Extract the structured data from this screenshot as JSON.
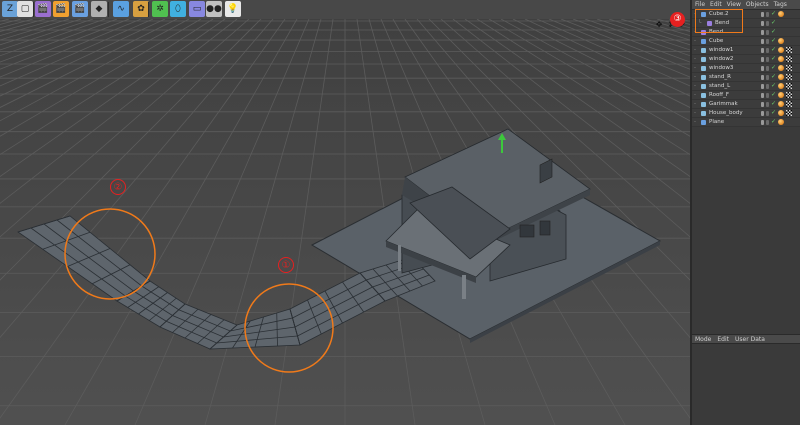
{
  "toolbar": {
    "buttons": [
      {
        "name": "z-axis-icon",
        "glyph": "Z"
      },
      {
        "name": "world-coordinates-icon",
        "glyph": "▢"
      },
      {
        "name": "render-view-icon",
        "glyph": "🎬"
      },
      {
        "name": "render-picture-viewer-icon",
        "glyph": "🎬"
      },
      {
        "name": "render-settings-icon",
        "glyph": "🎬"
      },
      {
        "name": "cube-primitive-icon",
        "glyph": "◆"
      },
      {
        "name": "spline-pen-icon",
        "glyph": "∿"
      },
      {
        "name": "subdivision-nurbs-icon",
        "glyph": "✿"
      },
      {
        "name": "array-icon",
        "glyph": "✲"
      },
      {
        "name": "deformer-icon",
        "glyph": "⬯"
      },
      {
        "name": "floor-scene-icon",
        "glyph": "▭"
      },
      {
        "name": "camera-icon",
        "glyph": "●●"
      },
      {
        "name": "light-icon",
        "glyph": "💡"
      }
    ]
  },
  "viewport": {
    "nav_icons": "✥ ↕ ⟳",
    "annotations": [
      {
        "label": "①"
      },
      {
        "label": "②"
      },
      {
        "label": "③"
      }
    ]
  },
  "object_manager": {
    "menu": [
      "File",
      "Edit",
      "View",
      "Objects",
      "Tags"
    ],
    "rows": [
      {
        "name": "Cube.2",
        "indent": 0,
        "icon_color": "#6aa0e0",
        "tags": [
          "phong"
        ]
      },
      {
        "name": "Bend",
        "indent": 1,
        "icon_color": "#9b7fe0",
        "tags": []
      },
      {
        "name": "Bend",
        "indent": 0,
        "icon_color": "#9b7fe0",
        "tags": []
      },
      {
        "name": "Cube",
        "indent": 0,
        "icon_color": "#6aa0e0",
        "tags": [
          "phong"
        ]
      },
      {
        "name": "window1",
        "indent": 0,
        "icon_color": "#8ac0e0",
        "tags": [
          "phong",
          "checker"
        ]
      },
      {
        "name": "window2",
        "indent": 0,
        "icon_color": "#8ac0e0",
        "tags": [
          "phong",
          "checker"
        ]
      },
      {
        "name": "window3",
        "indent": 0,
        "icon_color": "#8ac0e0",
        "tags": [
          "phong",
          "checker"
        ]
      },
      {
        "name": "stand_R",
        "indent": 0,
        "icon_color": "#8ac0e0",
        "tags": [
          "phong",
          "checker"
        ]
      },
      {
        "name": "stand_L",
        "indent": 0,
        "icon_color": "#8ac0e0",
        "tags": [
          "phong",
          "checker"
        ]
      },
      {
        "name": "Rooff_F",
        "indent": 0,
        "icon_color": "#8ac0e0",
        "tags": [
          "phong",
          "checker"
        ]
      },
      {
        "name": "Garimmak",
        "indent": 0,
        "icon_color": "#8ac0e0",
        "tags": [
          "phong",
          "checker"
        ]
      },
      {
        "name": "House_body",
        "indent": 0,
        "icon_color": "#8ac0e0",
        "tags": [
          "phong",
          "checker"
        ]
      },
      {
        "name": "Plane",
        "indent": 0,
        "icon_color": "#6aa0e0",
        "tags": [
          "phong"
        ]
      }
    ]
  },
  "attribute_manager": {
    "menu": [
      "Mode",
      "Edit",
      "User Data"
    ]
  },
  "colors": {
    "highlight": "#f07a1a",
    "annotation": "#e62020",
    "viewport_bg": "#4b4b4b",
    "grid": "#5a5a5a"
  }
}
